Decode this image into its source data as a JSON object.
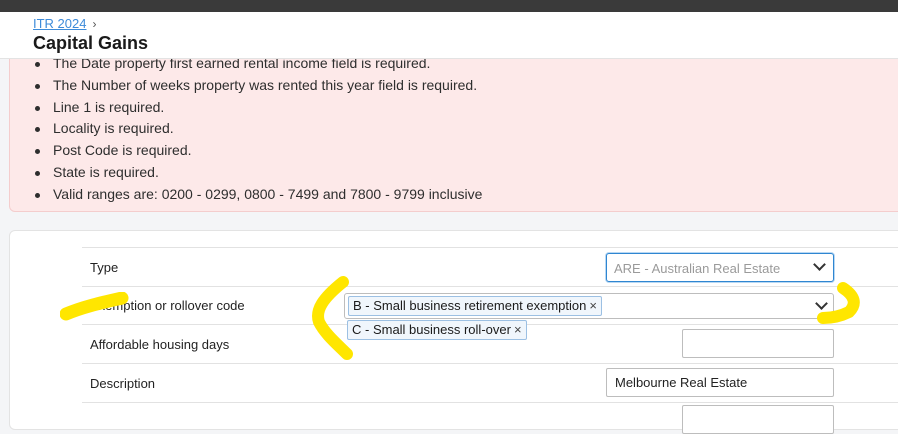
{
  "breadcrumb": {
    "link": "ITR 2024",
    "separator": "›"
  },
  "page": {
    "title": "Capital Gains"
  },
  "errors": [
    "The Date property first earned rental income field is required.",
    "The Number of weeks property was rented this year field is required.",
    "Line 1 is required.",
    "Locality is required.",
    "Post Code is required.",
    "State is required.",
    "Valid ranges are: 0200 - 0299, 0800 - 7499 and 7800 - 9799 inclusive"
  ],
  "form": {
    "type": {
      "label": "Type",
      "value": "ARE - Australian Real Estate"
    },
    "exemption": {
      "label": "Exemption or rollover code",
      "tags": [
        "B - Small business retirement exemption",
        "C - Small business roll-over"
      ]
    },
    "housing_days": {
      "label": "Affordable housing days",
      "value": ""
    },
    "description": {
      "label": "Description",
      "value": "Melbourne Real Estate"
    }
  },
  "colors": {
    "highlight": "#ffe600",
    "link": "#3d8bd9",
    "alert_bg": "#fde9e9",
    "focus": "#2f86d1"
  },
  "icons": {
    "tag_remove": "×"
  }
}
